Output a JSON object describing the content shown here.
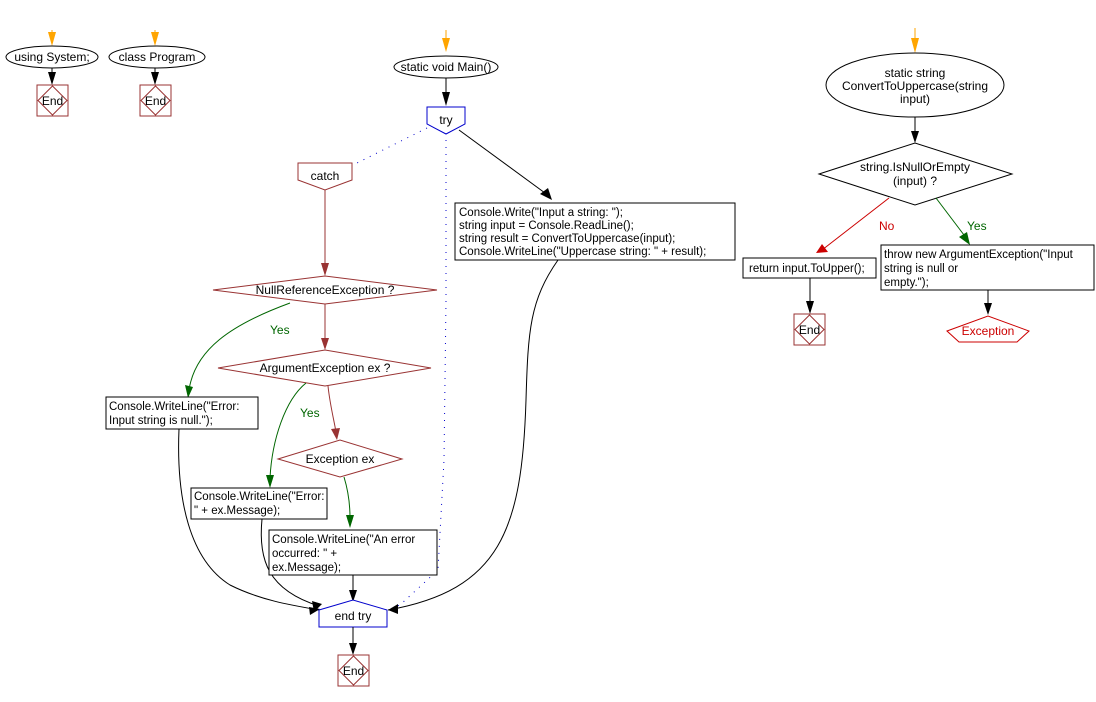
{
  "colors": {
    "entry_arrow": "#ffa500",
    "flow": "#000000",
    "catch_red": "#993333",
    "try_blue": "#0000cc",
    "yes_green": "#006600",
    "no_red": "#cc0000",
    "exception_red": "#cc0000"
  },
  "blocks": {
    "using": {
      "text": "using System;",
      "end": "End"
    },
    "program": {
      "text": "class Program",
      "end": "End"
    },
    "main": {
      "title": "static void Main()",
      "try": "try",
      "catch": "catch",
      "body": [
        "Console.Write(\"Input a string: \");",
        "string input = Console.ReadLine();",
        "string result = ConvertToUppercase(input);",
        "Console.WriteLine(\"Uppercase string: \" + result);"
      ],
      "null_ref_check": "NullReferenceException ?",
      "arg_check": "ArgumentException ex ?",
      "ex_check": "Exception ex",
      "yes1": "Yes",
      "yes2": "Yes",
      "null_ref_action": [
        "Console.WriteLine(\"Error:",
        "Input string is null.\");"
      ],
      "arg_action": [
        "Console.WriteLine(\"Error:",
        "\" + ex.Message);"
      ],
      "ex_action": [
        "Console.WriteLine(\"An error",
        "occurred: \" +",
        "ex.Message);"
      ],
      "end_try": "end try",
      "end": "End"
    },
    "convert": {
      "title": [
        "static string",
        "ConvertToUppercase(string",
        "input)"
      ],
      "check": [
        "string.IsNullOrEmpty",
        "(input) ?"
      ],
      "no": "No",
      "yes": "Yes",
      "return_action": "return input.ToUpper();",
      "throw_action": [
        "throw new ArgumentException(\"Input",
        "string is null or",
        "empty.\");"
      ],
      "end": "End",
      "exception": "Exception"
    }
  }
}
